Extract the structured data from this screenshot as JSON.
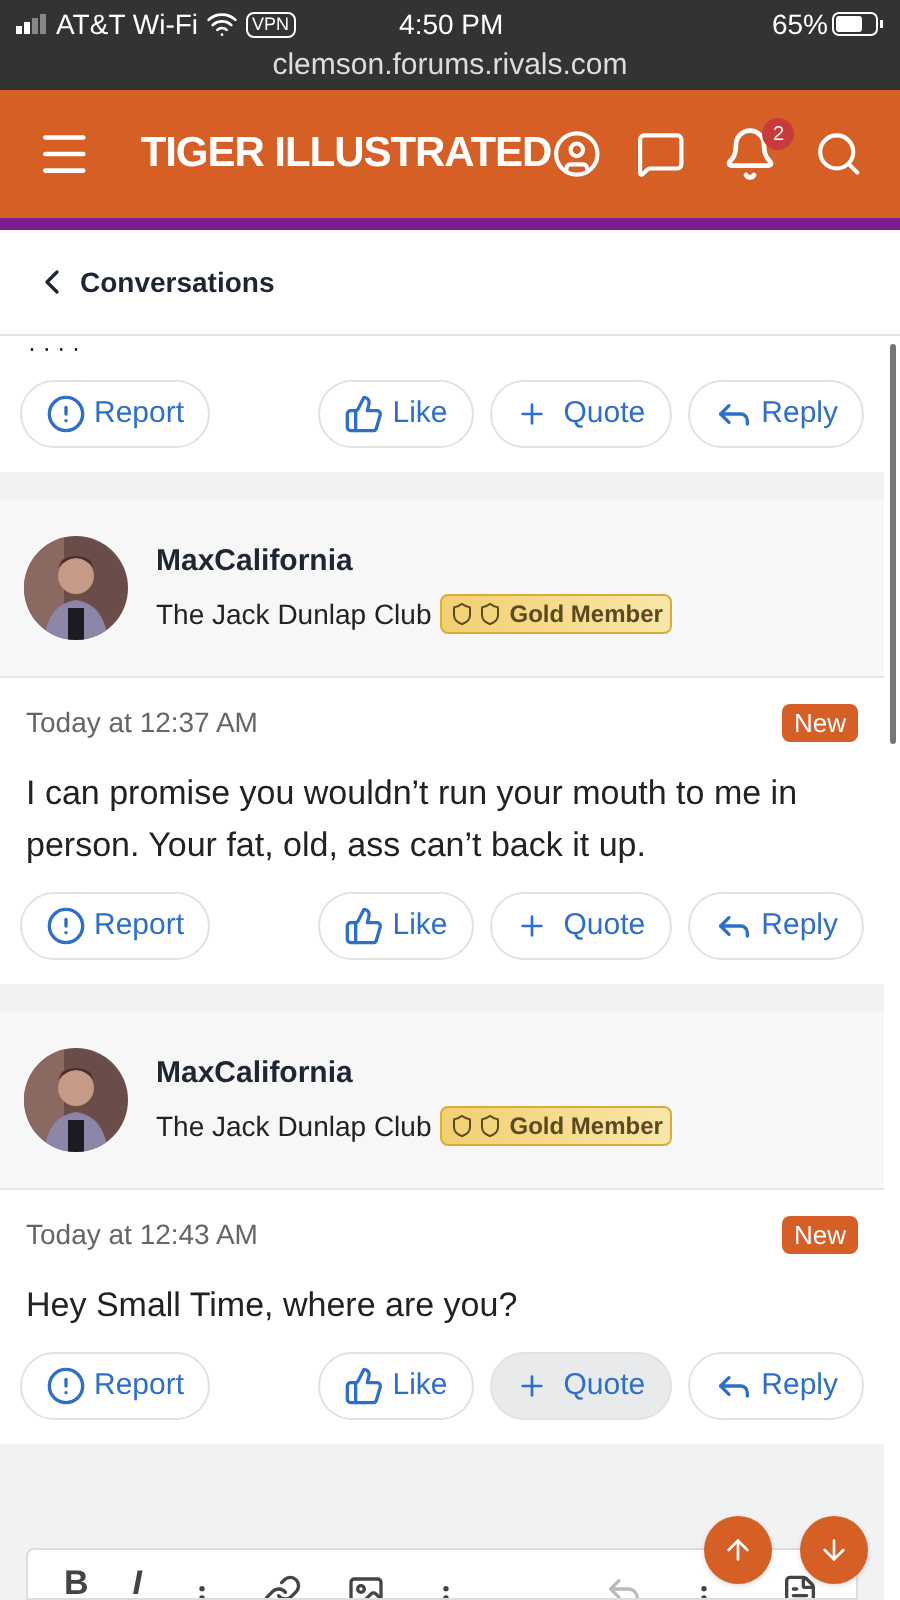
{
  "status_bar": {
    "carrier": "AT&T Wi-Fi",
    "vpn": "VPN",
    "time": "4:50 PM",
    "battery": "65%",
    "url": "clemson.forums.rivals.com"
  },
  "header": {
    "logo": "TIGER ILLUSTRATED",
    "notification_count": "2"
  },
  "breadcrumb": {
    "label": "Conversations"
  },
  "previous_tail": {
    "text": "· · · ·",
    "actions": [
      {
        "kind": "report",
        "label": "Report",
        "highlighted": false
      },
      {
        "kind": "like",
        "label": "Like",
        "highlighted": false
      },
      {
        "kind": "quote",
        "label": "Quote",
        "highlighted": false
      },
      {
        "kind": "reply",
        "label": "Reply",
        "highlighted": false
      }
    ]
  },
  "messages": [
    {
      "author": "MaxCalifornia",
      "club": "The Jack Dunlap Club",
      "badge": "Gold Member",
      "time": "Today at 12:37 AM",
      "tag": "New",
      "text": "I can promise you wouldn’t run your mouth to me in person. Your fat, old, ass can’t back it up.",
      "actions": [
        {
          "kind": "report",
          "label": "Report",
          "highlighted": false
        },
        {
          "kind": "like",
          "label": "Like",
          "highlighted": false
        },
        {
          "kind": "quote",
          "label": "Quote",
          "highlighted": false
        },
        {
          "kind": "reply",
          "label": "Reply",
          "highlighted": false
        }
      ]
    },
    {
      "author": "MaxCalifornia",
      "club": "The Jack Dunlap Club",
      "badge": "Gold Member",
      "time": "Today at 12:43 AM",
      "tag": "New",
      "text": "Hey Small Time, where are you?",
      "actions": [
        {
          "kind": "report",
          "label": "Report",
          "highlighted": false
        },
        {
          "kind": "like",
          "label": "Like",
          "highlighted": false
        },
        {
          "kind": "quote",
          "label": "Quote",
          "highlighted": true
        },
        {
          "kind": "reply",
          "label": "Reply",
          "highlighted": false
        }
      ]
    }
  ],
  "editor": {
    "bold": "B",
    "italic": "I"
  }
}
